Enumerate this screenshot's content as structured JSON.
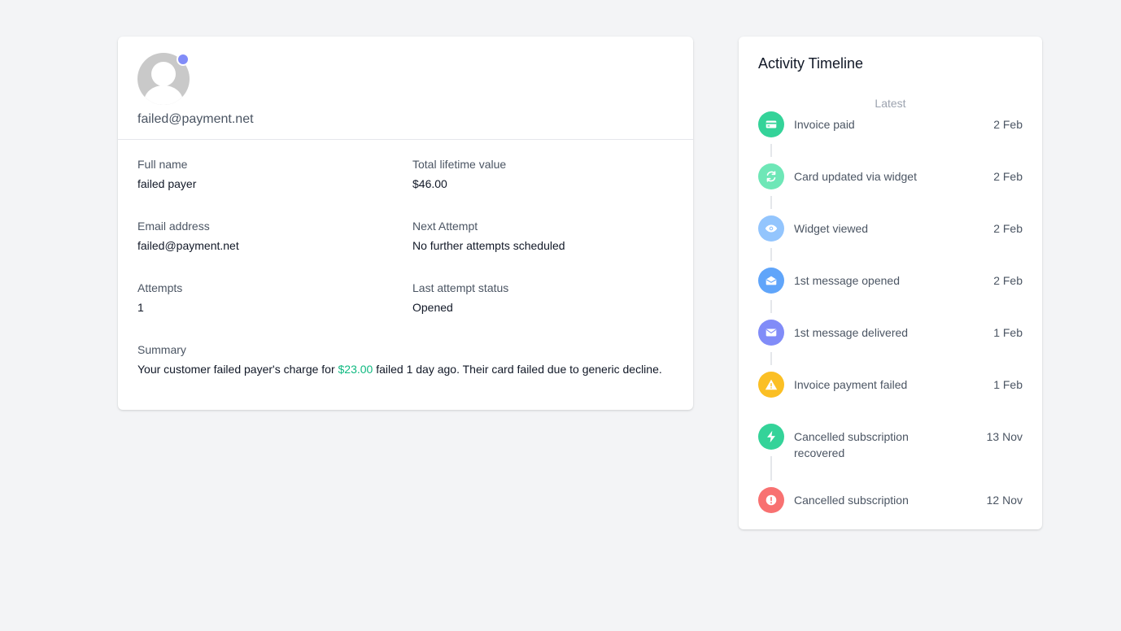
{
  "customer": {
    "email_header": "failed@payment.net",
    "fields": {
      "full_name": {
        "label": "Full name",
        "value": "failed payer"
      },
      "lifetime_value": {
        "label": "Total lifetime value",
        "value": "$46.00"
      },
      "email": {
        "label": "Email address",
        "value": "failed@payment.net"
      },
      "next_attempt": {
        "label": "Next Attempt",
        "value": "No further attempts scheduled"
      },
      "attempts": {
        "label": "Attempts",
        "value": "1"
      },
      "last_status": {
        "label": "Last attempt status",
        "value": "Opened"
      }
    },
    "summary": {
      "label": "Summary",
      "prefix": "Your customer failed payer's charge for ",
      "amount": "$23.00",
      "suffix": " failed 1 day ago. Their card failed due to generic decline."
    },
    "status_dot_color": "#818cf8"
  },
  "timeline": {
    "title": "Activity Timeline",
    "latest_label": "Latest",
    "items": [
      {
        "label": "Invoice paid",
        "date": "2 Feb",
        "icon": "credit-card-icon",
        "color": "#34d399"
      },
      {
        "label": "Card updated via widget",
        "date": "2 Feb",
        "icon": "refresh-icon",
        "color": "#6ee7b7"
      },
      {
        "label": "Widget viewed",
        "date": "2 Feb",
        "icon": "eye-icon",
        "color": "#93c5fd"
      },
      {
        "label": "1st message opened",
        "date": "2 Feb",
        "icon": "mail-open-icon",
        "color": "#60a5fa"
      },
      {
        "label": "1st message delivered",
        "date": "1 Feb",
        "icon": "mail-icon",
        "color": "#818cf8"
      },
      {
        "label": "Invoice payment failed",
        "date": "1 Feb",
        "icon": "warning-icon",
        "color": "#fbbf24"
      },
      {
        "label": "Cancelled subscription recovered",
        "date": "13 Nov",
        "icon": "lightning-icon",
        "color": "#34d399"
      },
      {
        "label": "Cancelled subscription",
        "date": "12 Nov",
        "icon": "exclamation-icon",
        "color": "#f87171"
      }
    ]
  }
}
